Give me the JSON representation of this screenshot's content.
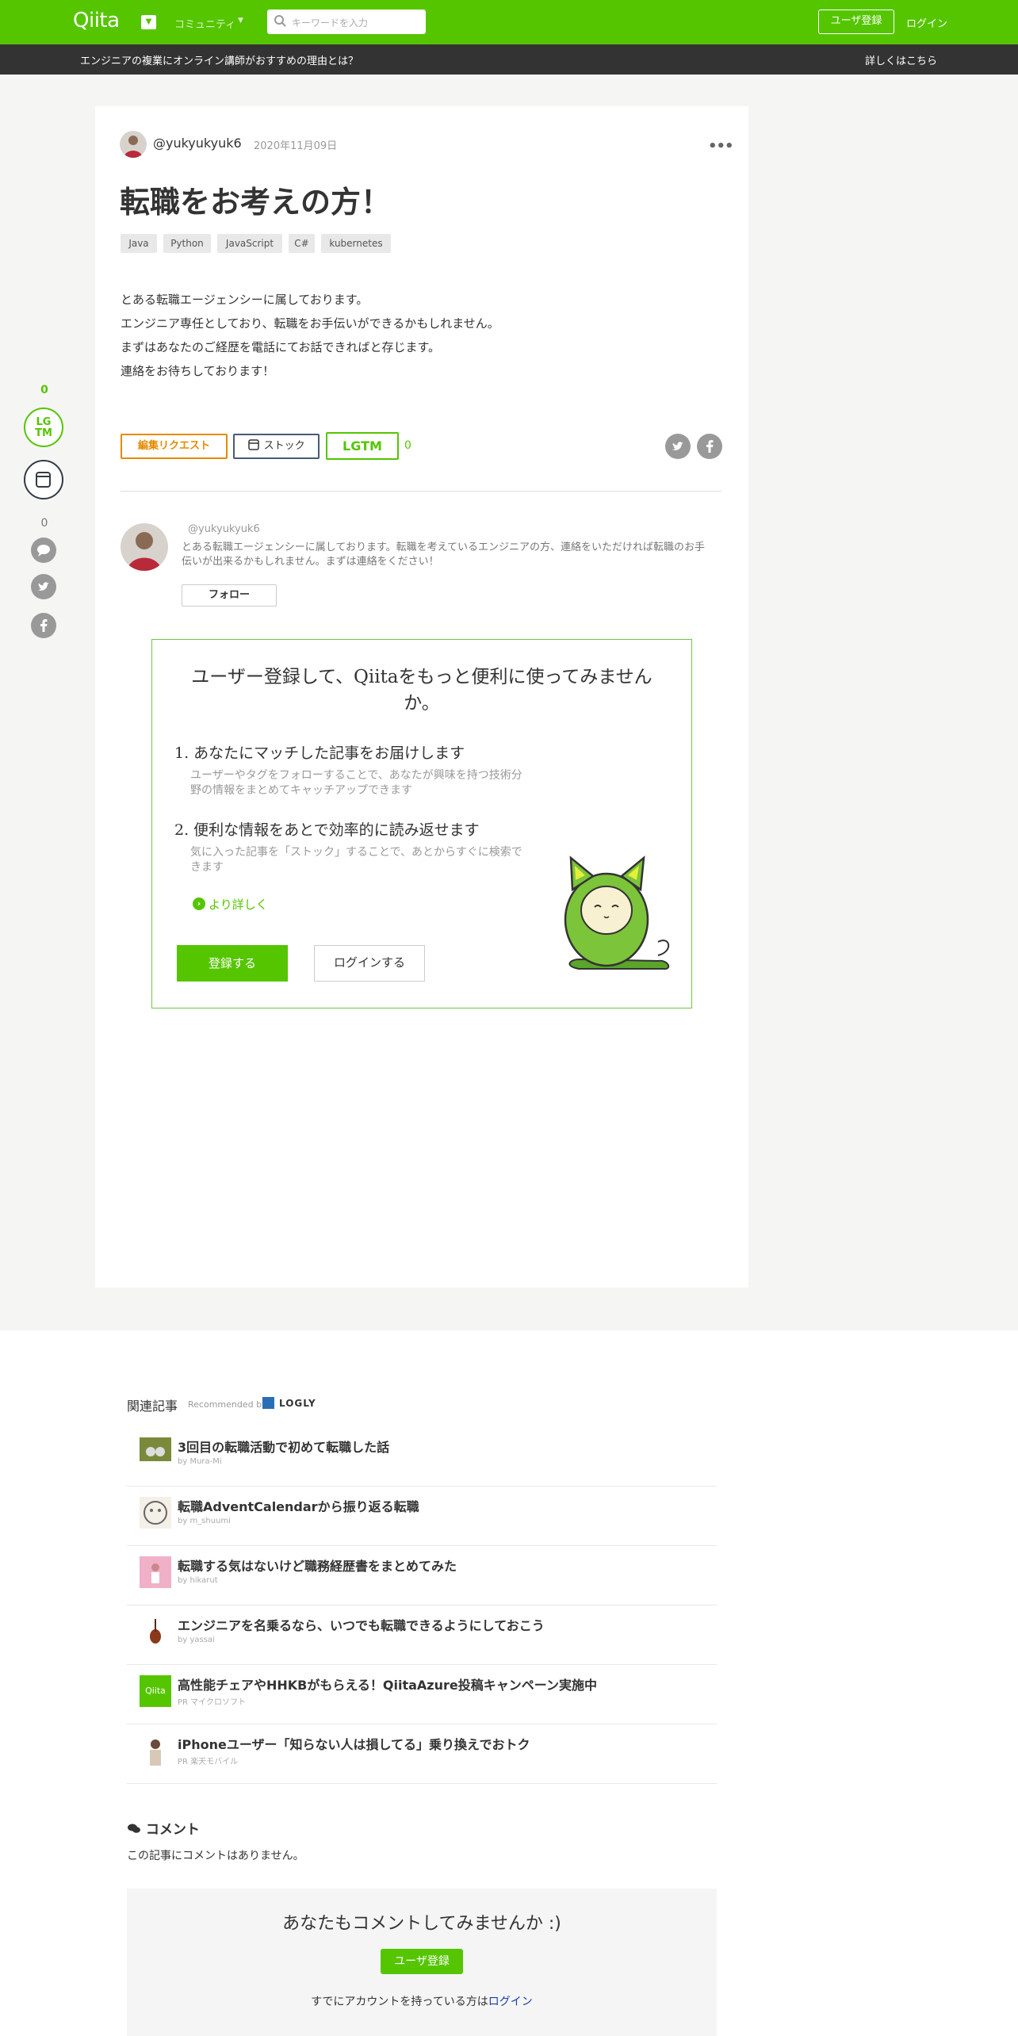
{
  "header": {
    "logo": "Qiita",
    "community_label": "コミュニティ",
    "search_placeholder": "キーワードを入力",
    "signup_label": "ユーザ登録",
    "login_label": "ログイン"
  },
  "banner": {
    "text": "エンジニアの複業にオンライン講師がおすすめの理由とは？",
    "link": "詳しくはこちら"
  },
  "rail": {
    "lgtm_count": "0",
    "lgtm_label_1": "LG",
    "lgtm_label_2": "TM",
    "comment_count": "0"
  },
  "article": {
    "author": "@yukyukyuk6",
    "date": "2020年11月09日",
    "title": "転職をお考えの方！",
    "tags": [
      "Java",
      "Python",
      "JavaScript",
      "C#",
      "kubernetes"
    ],
    "body": [
      "とある転職エージェンシーに属しております。",
      "エンジニア専任としており、転職をお手伝いができるかもしれません。",
      "まずはあなたのご経歴を電話にてお話できればと存じます。",
      "連絡をお待ちしております！"
    ],
    "edit_request": "編集リクエスト",
    "stock": "ストック",
    "lgtm": "LGTM",
    "lgtm_count": "0"
  },
  "profile": {
    "name": "@yukyukyuk6",
    "desc": "とある転職エージェンシーに属しております。転職を考えているエンジニアの方、連絡をいただければ転職のお手伝いが出来るかもしれません。まずは連絡をください！",
    "follow": "フォロー"
  },
  "promo": {
    "title": "ユーザー登録して、Qiitaをもっと便利に使ってみませんか。",
    "features": [
      {
        "title": "1. あなたにマッチした記事をお届けします",
        "desc": "ユーザーやタグをフォローすることで、あなたが興味を持つ技術分野の情報をまとめてキャッチアップできます"
      },
      {
        "title": "2. 便利な情報をあとで効率的に読み返せます",
        "desc": "気に入った記事を「ストック」することで、あとからすぐに検索できます"
      }
    ],
    "more": "より詳しく",
    "register": "登録する",
    "login": "ログインする"
  },
  "related": {
    "heading": "関連記事",
    "recommended_by": "Recommended by",
    "logly": "LOGLY",
    "items": [
      {
        "title": "3回目の転職活動で初めて転職した話",
        "by": "by Mura-Mi"
      },
      {
        "title": "転職AdventCalendarから振り返る転職",
        "by": "by m_shuumi"
      },
      {
        "title": "転職する気はないけど職務経歴書をまとめてみた",
        "by": "by hikarut"
      },
      {
        "title": "エンジニアを名乗るなら、いつでも転職できるようにしておこう",
        "by": "by yassai"
      },
      {
        "title": "高性能チェアやHHKBがもらえる！QiitaAzure投稿キャンペーン実施中",
        "by": "PR マイクロソフト"
      },
      {
        "title": "iPhoneユーザー「知らない人は損してる」乗り換えでおトク",
        "by": "PR 楽天モバイル"
      }
    ],
    "qiita_thumb_label": "Qiita"
  },
  "comments": {
    "heading": "コメント",
    "empty": "この記事にコメントはありません。",
    "prompt": "あなたもコメントしてみませんか :)",
    "signup": "ユーザ登録",
    "login_prefix": "すでにアカウントを持っている方は",
    "login_link": "ログイン"
  },
  "colors": {
    "brand": "#55c500",
    "banner": "#333333",
    "edit_request": "#e68a00"
  }
}
